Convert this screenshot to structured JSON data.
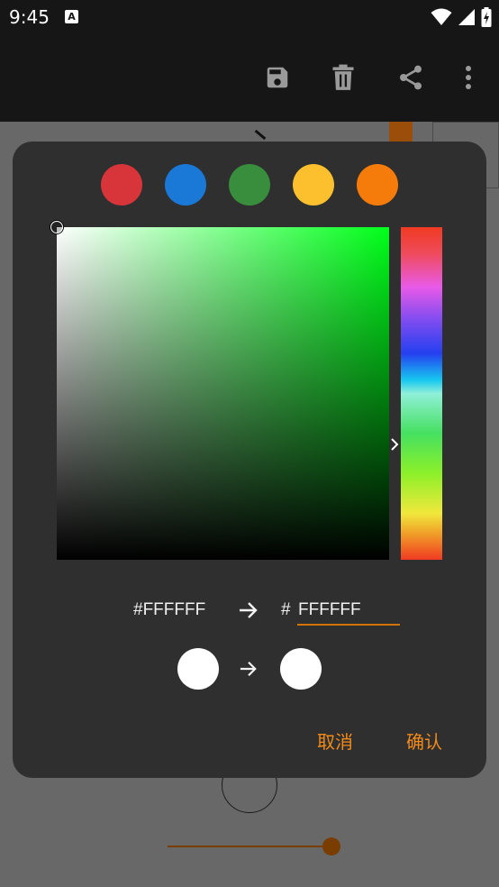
{
  "status": {
    "time": "9:45",
    "a_badge": "A"
  },
  "toolbar": {
    "icons": [
      "save-icon",
      "delete-icon",
      "share-icon",
      "more-vert-icon"
    ]
  },
  "dialog": {
    "presets": [
      {
        "name": "red",
        "color": "#d8353b"
      },
      {
        "name": "blue",
        "color": "#1a78d6"
      },
      {
        "name": "green",
        "color": "#388e3c"
      },
      {
        "name": "yellow",
        "color": "#fcc02e"
      },
      {
        "name": "orange",
        "color": "#f57c0a"
      }
    ],
    "picker": {
      "hue_color": "#00ff1a"
    },
    "hex": {
      "old": "#FFFFFF",
      "hash": "#",
      "new_value": "FFFFFF"
    },
    "swatches": {
      "old_color": "#ffffff",
      "new_color": "#ffffff"
    },
    "buttons": {
      "cancel": "取消",
      "confirm": "确认"
    },
    "accent": "#f28b1a"
  }
}
